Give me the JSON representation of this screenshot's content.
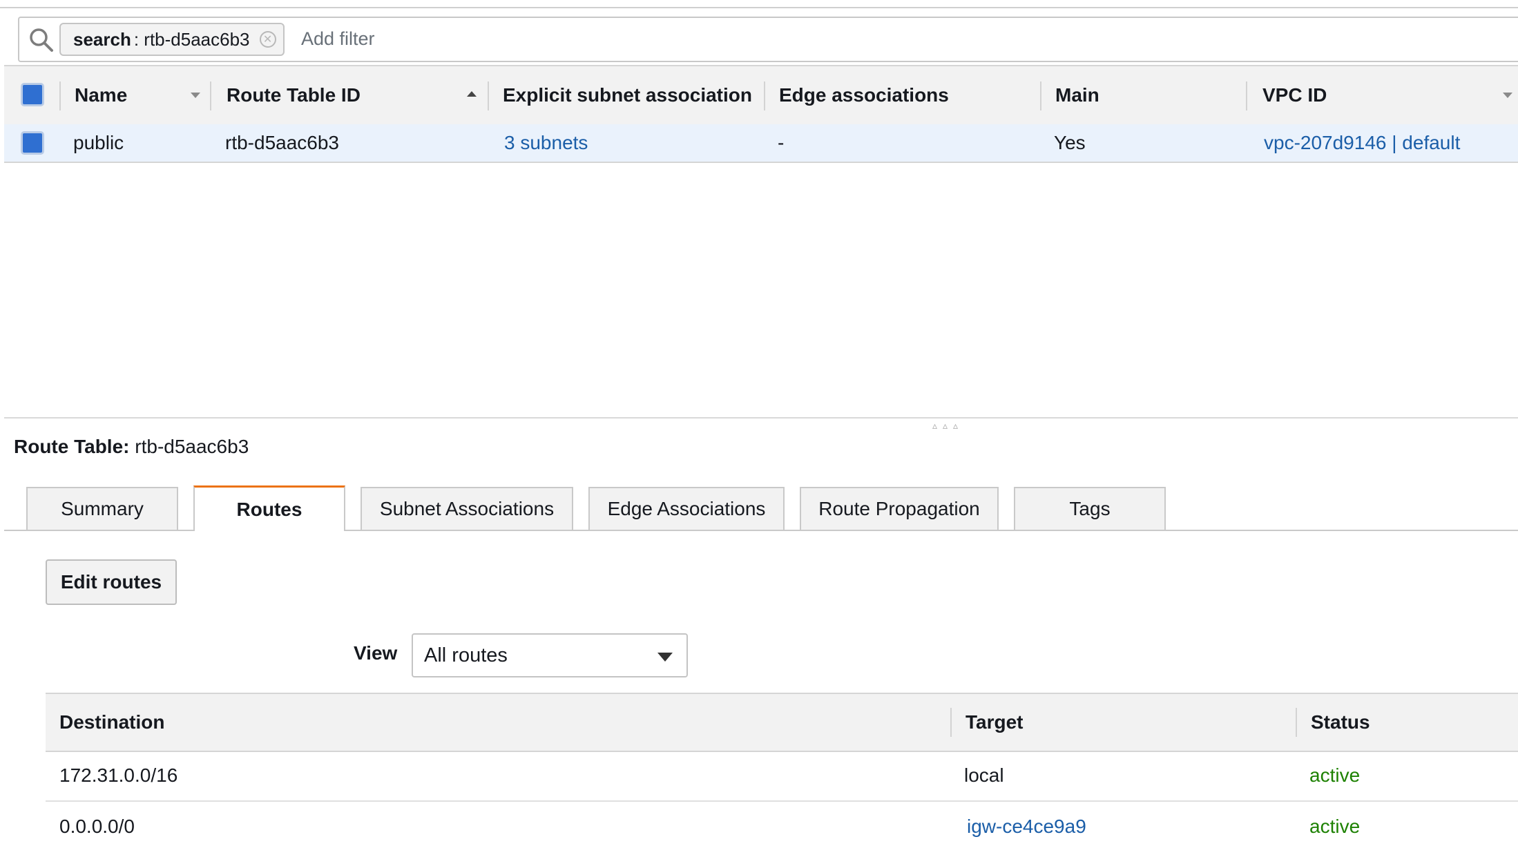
{
  "filter": {
    "token_key": "search",
    "token_value": ": rtb-d5aac6b3",
    "add_filter_placeholder": "Add filter"
  },
  "table": {
    "columns": [
      "Name",
      "Route Table ID",
      "Explicit subnet association",
      "Edge associations",
      "Main",
      "VPC ID"
    ],
    "rows": [
      {
        "name": "public",
        "route_table_id": "rtb-d5aac6b3",
        "explicit_subnet_association": "3 subnets",
        "edge_associations": "-",
        "main": "Yes",
        "vpc_id": "vpc-207d9146 | default"
      }
    ]
  },
  "detail": {
    "label": "Route Table:",
    "value": "rtb-d5aac6b3"
  },
  "tabs": [
    "Summary",
    "Routes",
    "Subnet Associations",
    "Edge Associations",
    "Route Propagation",
    "Tags"
  ],
  "active_tab": "Routes",
  "edit_routes_label": "Edit routes",
  "view": {
    "label": "View",
    "selected": "All routes"
  },
  "routes": {
    "columns": [
      "Destination",
      "Target",
      "Status"
    ],
    "rows": [
      {
        "destination": "172.31.0.0/16",
        "target": "local",
        "status": "active"
      },
      {
        "destination": "0.0.0.0/0",
        "target": "igw-ce4ce9a9",
        "status": "active"
      }
    ]
  },
  "colors": {
    "accent": "#ec7211",
    "link": "#1b5ea8",
    "status_active": "#1d8102",
    "checkbox": "#2f6fd1",
    "selected_row": "#eaf2fc"
  }
}
